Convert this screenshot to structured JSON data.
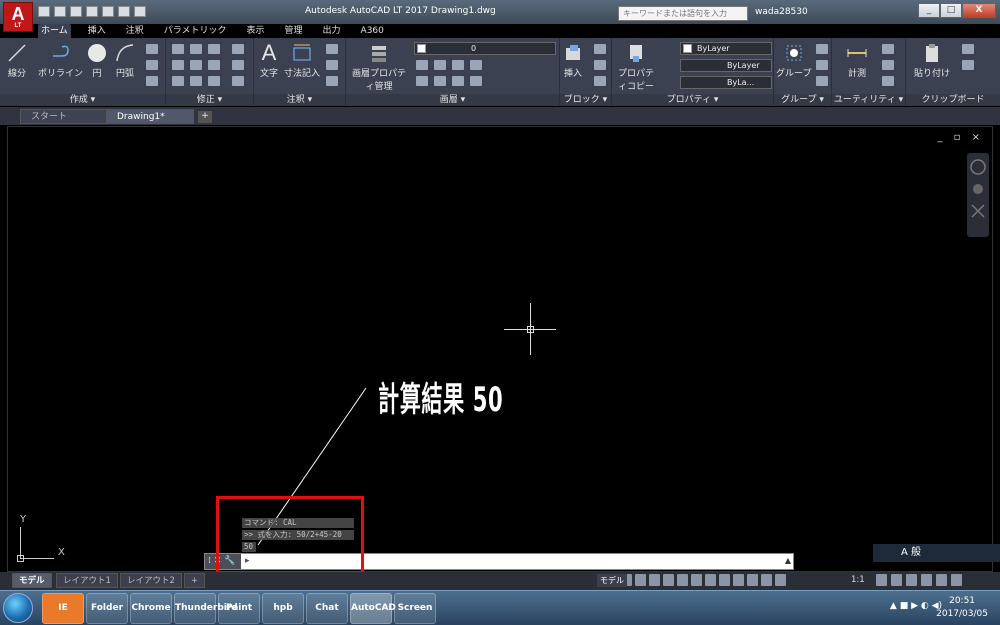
{
  "app": {
    "logo": "A",
    "logo_sub": "LT",
    "title": "Autodesk AutoCAD LT 2017      Drawing1.dwg",
    "search_placeholder": "キーワードまたは語句を入力",
    "user": "wada28530",
    "window_buttons": [
      "_",
      "□",
      "X"
    ]
  },
  "menu_tabs": [
    "ホーム",
    "挿入",
    "注釈",
    "パラメトリック",
    "表示",
    "管理",
    "出力",
    "A360"
  ],
  "ribbon": {
    "panels": {
      "draw": {
        "title": "作成 ▾",
        "tools": [
          "線分",
          "ポリライン",
          "円",
          "円弧"
        ]
      },
      "modify": {
        "title": "修正 ▾"
      },
      "annotate": {
        "title": "注釈 ▾",
        "tools": [
          "文字",
          "寸法記入"
        ]
      },
      "layers": {
        "title": "画層 ▾",
        "tool": "画層プロパティ管理",
        "layer_value": "0"
      },
      "block": {
        "title": "ブロック ▾",
        "tool": "挿入"
      },
      "properties": {
        "title": "プロパティ ▾",
        "tool": "プロパティコピー",
        "color": "ByLayer",
        "linetype": "ByLayer",
        "lineweight": "ByLa..."
      },
      "groups": {
        "title": "グループ ▾",
        "tool": "グループ"
      },
      "utilities": {
        "title": "ユーティリティ ▾",
        "tool": "計測"
      },
      "clipboard": {
        "title": "クリップボード",
        "tool": "貼り付け"
      }
    }
  },
  "doc_tabs": [
    "スタート",
    "Drawing1*"
  ],
  "canvas": {
    "viewport_controls": "_ ▫ ×",
    "ucs_x": "X",
    "ucs_y": "Y",
    "annotation": "計算結果 50"
  },
  "command": {
    "history": [
      "コマンド: CAL",
      ">> 式を入力: 50/2+45-20",
      "50"
    ],
    "handle": "⁞ ✕ 🔧",
    "input_value": "",
    "prompt_icon": "▸"
  },
  "layout_tabs": [
    "モデル",
    "レイアウト1",
    "レイアウト2",
    "+"
  ],
  "status": {
    "model": "モデル",
    "scale": "1:1"
  },
  "ime": "A 般",
  "taskbar": {
    "apps": [
      "IE",
      "Folder",
      "Chrome",
      "Thunderbird",
      "Paint",
      "hpb",
      "Chat",
      "AutoCAD",
      "Screen"
    ],
    "clock_time": "20:51",
    "clock_date": "2017/03/05"
  },
  "colors": {
    "highlight": "#e01010",
    "canvas_bg": "#000000",
    "ribbon_bg": "#3b4150"
  }
}
